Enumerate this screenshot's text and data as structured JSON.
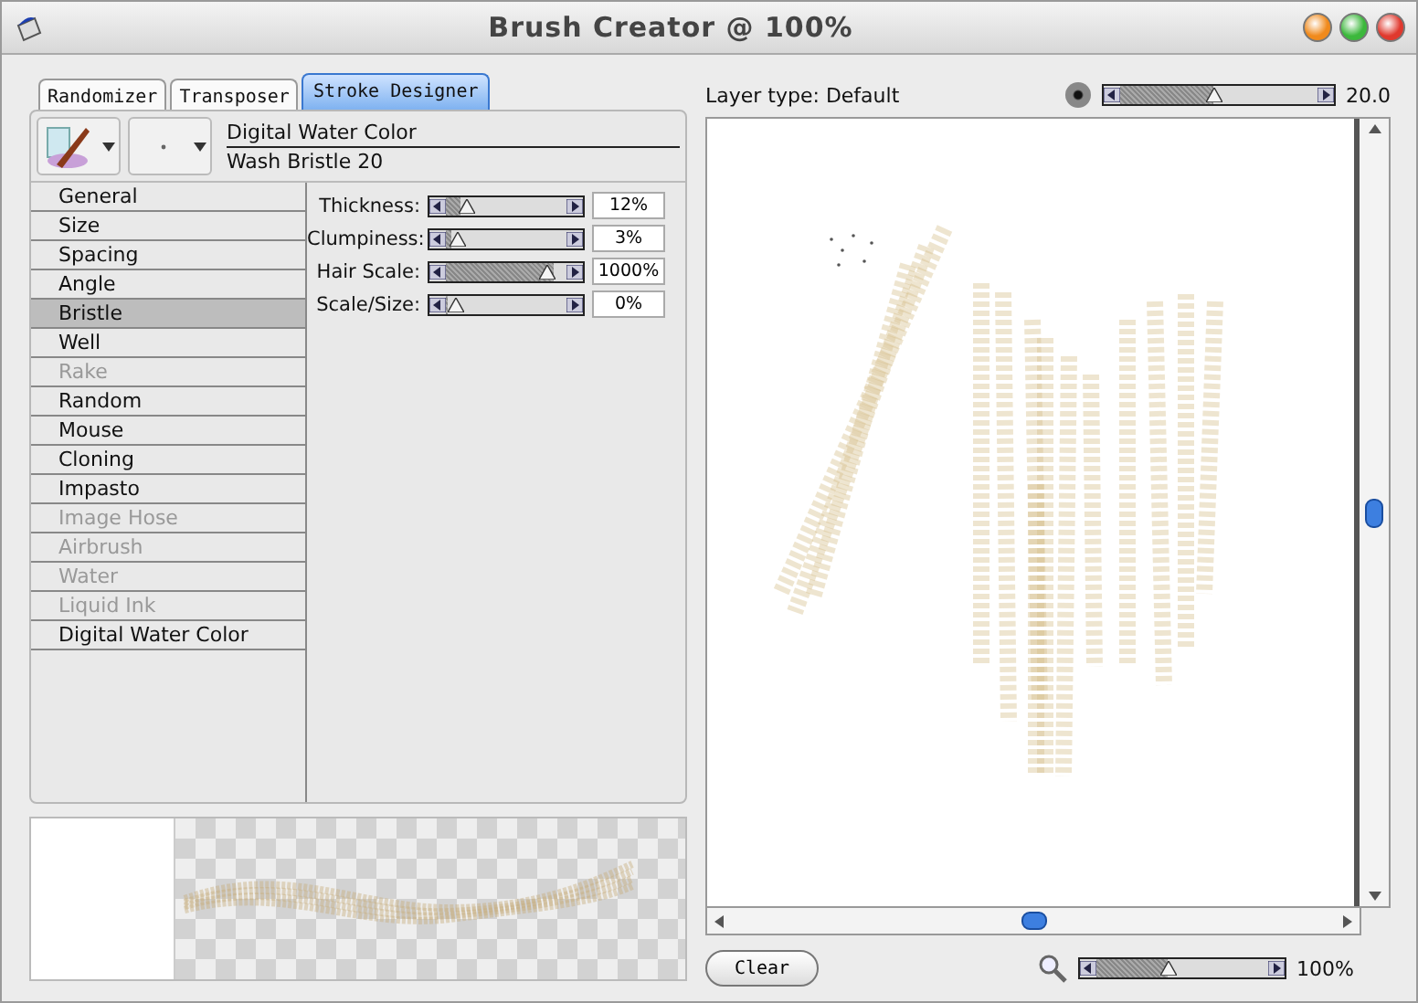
{
  "window": {
    "title": "Brush Creator @ 100%"
  },
  "tabs": [
    {
      "label": "Randomizer",
      "selected": false
    },
    {
      "label": "Transposer",
      "selected": false
    },
    {
      "label": "Stroke Designer",
      "selected": true
    }
  ],
  "brush": {
    "category": "Digital Water Color",
    "variant": "Wash Bristle 20"
  },
  "sections": [
    {
      "label": "General",
      "selected": false,
      "disabled": false
    },
    {
      "label": "Size",
      "selected": false,
      "disabled": false
    },
    {
      "label": "Spacing",
      "selected": false,
      "disabled": false
    },
    {
      "label": "Angle",
      "selected": false,
      "disabled": false
    },
    {
      "label": "Bristle",
      "selected": true,
      "disabled": false
    },
    {
      "label": "Well",
      "selected": false,
      "disabled": false
    },
    {
      "label": "Rake",
      "selected": false,
      "disabled": true
    },
    {
      "label": "Random",
      "selected": false,
      "disabled": false
    },
    {
      "label": "Mouse",
      "selected": false,
      "disabled": false
    },
    {
      "label": "Cloning",
      "selected": false,
      "disabled": false
    },
    {
      "label": "Impasto",
      "selected": false,
      "disabled": false
    },
    {
      "label": "Image Hose",
      "selected": false,
      "disabled": true
    },
    {
      "label": "Airbrush",
      "selected": false,
      "disabled": true
    },
    {
      "label": "Water",
      "selected": false,
      "disabled": true
    },
    {
      "label": "Liquid Ink",
      "selected": false,
      "disabled": true
    },
    {
      "label": "Digital Water Color",
      "selected": false,
      "disabled": false
    }
  ],
  "controls": [
    {
      "label": "Thickness:",
      "level": 0.12,
      "value": "12%"
    },
    {
      "label": "Clumpiness:",
      "level": 0.04,
      "value": "3%"
    },
    {
      "label": "Hair Scale:",
      "level": 0.9,
      "value": "1000%"
    },
    {
      "label": "Scale/Size:",
      "level": 0.02,
      "value": "0%"
    }
  ],
  "layer_type": "Layer type: Default",
  "size": {
    "level": 0.48,
    "value": "20.0"
  },
  "clear_button": "Clear",
  "zoom": {
    "level": 0.42,
    "value": "100%"
  }
}
